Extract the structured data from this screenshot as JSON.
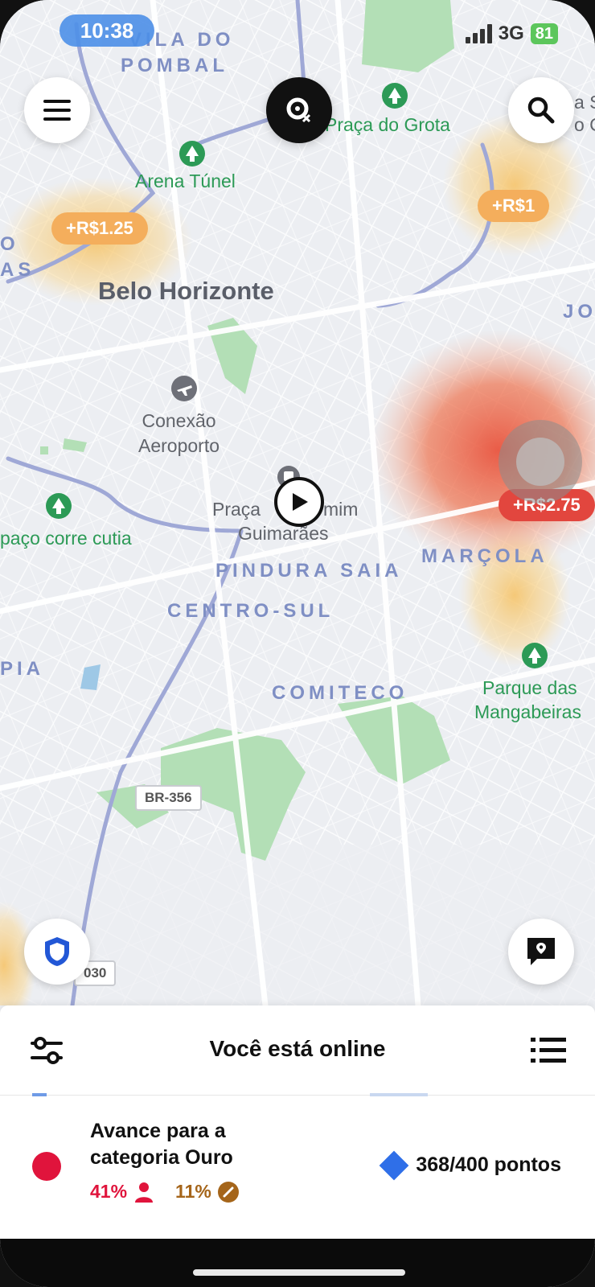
{
  "status_bar": {
    "time": "10:38",
    "network": "3G",
    "battery": "81"
  },
  "map": {
    "districts": [
      "VILA DO",
      "POMBAL",
      "PINDURA SAIA",
      "CENTRO-SUL",
      "COMITECO",
      "MARÇOLA",
      "JO",
      "PIA",
      "O",
      "AS"
    ],
    "city": "Belo Horizonte",
    "parks": [
      "Praça do Grota",
      "Arena Túnel",
      "paço corre cutia",
      "Parque das",
      "Mangabeiras"
    ],
    "pois": [
      "Conexão",
      "Aeroporto",
      "Praça",
      "mim",
      "Guimarães"
    ],
    "edge_labels": [
      "a S",
      "o G"
    ],
    "road_signs": [
      "BR-356",
      "030"
    ],
    "surges": [
      "+R$1.25",
      "+R$1",
      "+R$2.75"
    ]
  },
  "panel": {
    "title": "Você está online",
    "tier_title": "Avance para a categoria Ouro",
    "acceptance": "41%",
    "cancellation": "11%",
    "points": "368/400 pontos"
  },
  "icons": {
    "menu": "menu-icon",
    "search": "search-icon",
    "destination": "destination-filter-icon",
    "safety": "shield-icon",
    "report": "map-report-icon",
    "filters": "filters-icon",
    "list": "list-icon",
    "location": "navigation-arrow-icon"
  },
  "colors": {
    "surge_orange": "#f4ae5c",
    "surge_red": "#e2463e",
    "tier_red": "#e0143c",
    "points_blue": "#2f6fe8"
  }
}
